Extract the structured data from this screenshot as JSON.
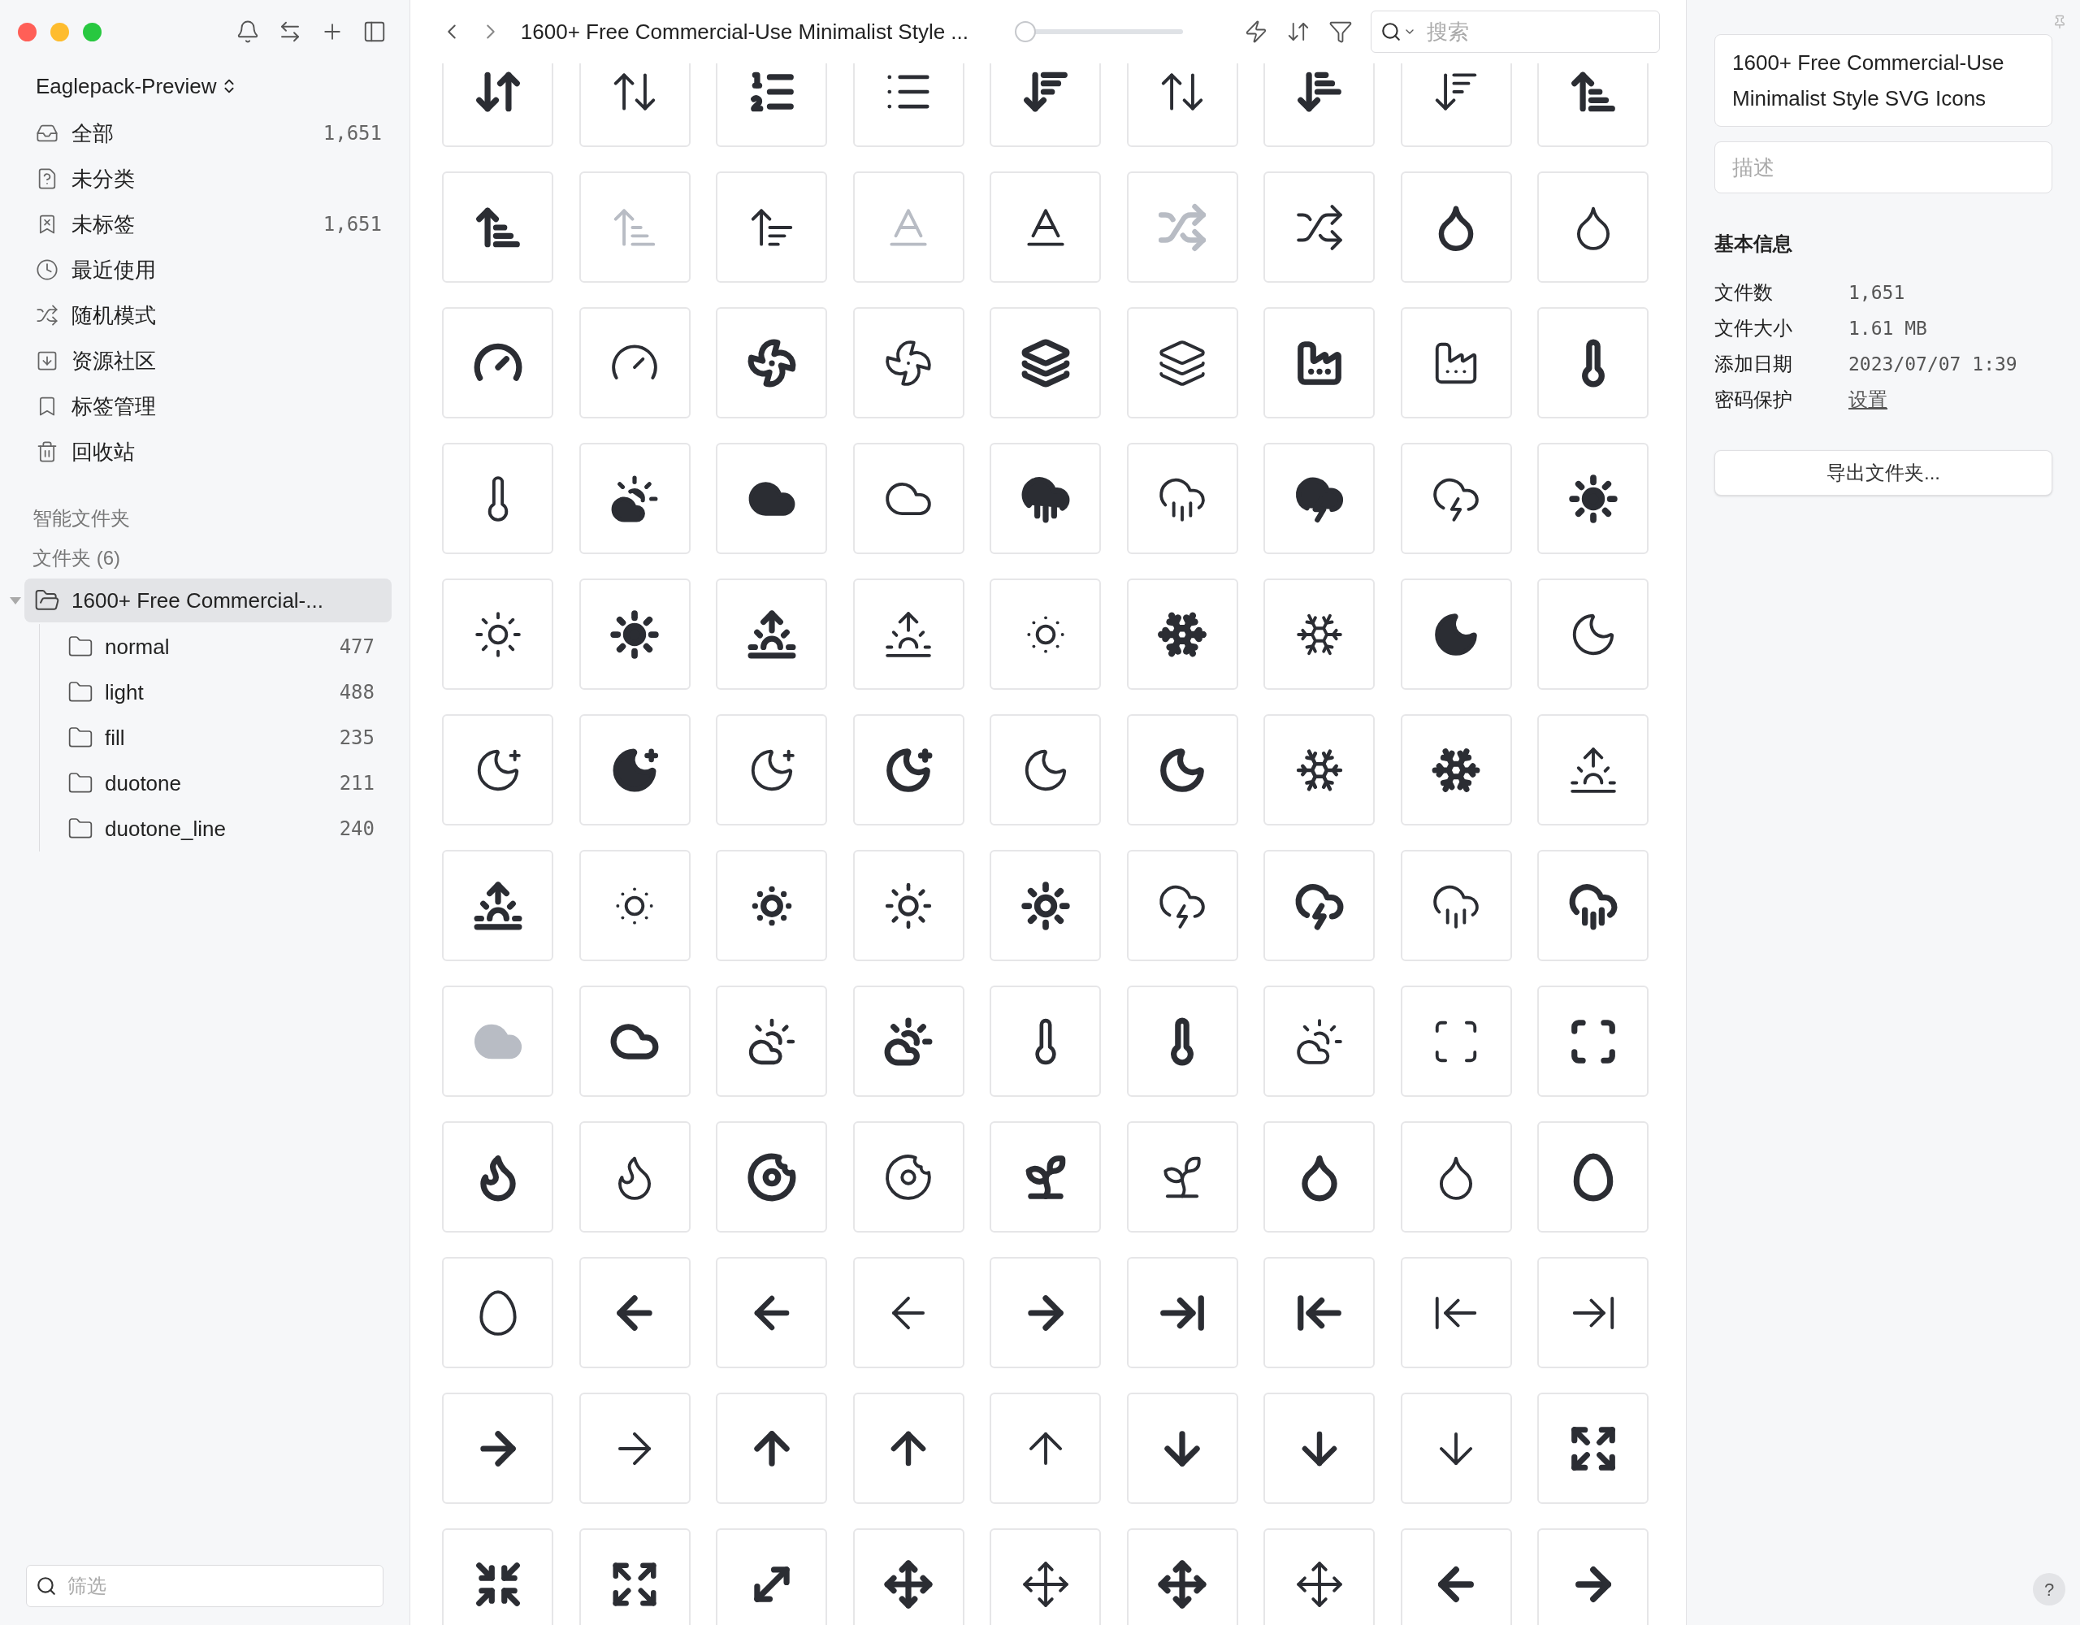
{
  "sidebar": {
    "library": "Eaglepack-Preview",
    "nav": [
      {
        "kind": "all",
        "label": "全部",
        "count": "1,651",
        "selected": false
      },
      {
        "kind": "uncategorized",
        "label": "未分类",
        "selected": false
      },
      {
        "kind": "untagged",
        "label": "未标签",
        "count": "1,651",
        "selected": false
      },
      {
        "kind": "recent",
        "label": "最近使用",
        "selected": false
      },
      {
        "kind": "random",
        "label": "随机模式",
        "selected": false
      },
      {
        "kind": "community",
        "label": "资源社区",
        "selected": false
      },
      {
        "kind": "tags",
        "label": "标签管理",
        "selected": false
      },
      {
        "kind": "trash",
        "label": "回收站",
        "selected": false
      }
    ],
    "smart_folders": "智能文件夹",
    "folders_heading": "文件夹 (6)",
    "folders": [
      {
        "label": "1600+ Free Commercial-...",
        "selected": true,
        "expanded": true,
        "children": [
          {
            "label": "normal",
            "count": "477",
            "selected": false
          },
          {
            "label": "light",
            "count": "488",
            "selected": false
          },
          {
            "label": "fill",
            "count": "235",
            "selected": false
          },
          {
            "label": "duotone",
            "count": "211",
            "selected": false
          },
          {
            "label": "duotone_line",
            "count": "240",
            "selected": false
          }
        ]
      }
    ],
    "filter": {
      "placeholder": "筛选"
    }
  },
  "toolbar": {
    "title": "1600+ Free Commercial-Use Minimalist Style ...",
    "zoom_slider": {
      "level": 0
    },
    "search": {
      "placeholder": "搜索"
    }
  },
  "inspector": {
    "title": "1600+ Free Commercial-Use Minimalist Style SVG Icons",
    "description": {
      "placeholder": "描述"
    },
    "section": "基本信息",
    "info": [
      {
        "kind": "text",
        "label": "文件数",
        "value": "1,651"
      },
      {
        "kind": "text",
        "label": "文件大小",
        "value": "1.61 MB"
      },
      {
        "kind": "text",
        "label": "添加日期",
        "value": "2023/07/07 1:39"
      },
      {
        "kind": "link",
        "label": "密码保护",
        "value": "设置"
      }
    ],
    "export_button": "导出文件夹..."
  },
  "help_button": "?"
}
